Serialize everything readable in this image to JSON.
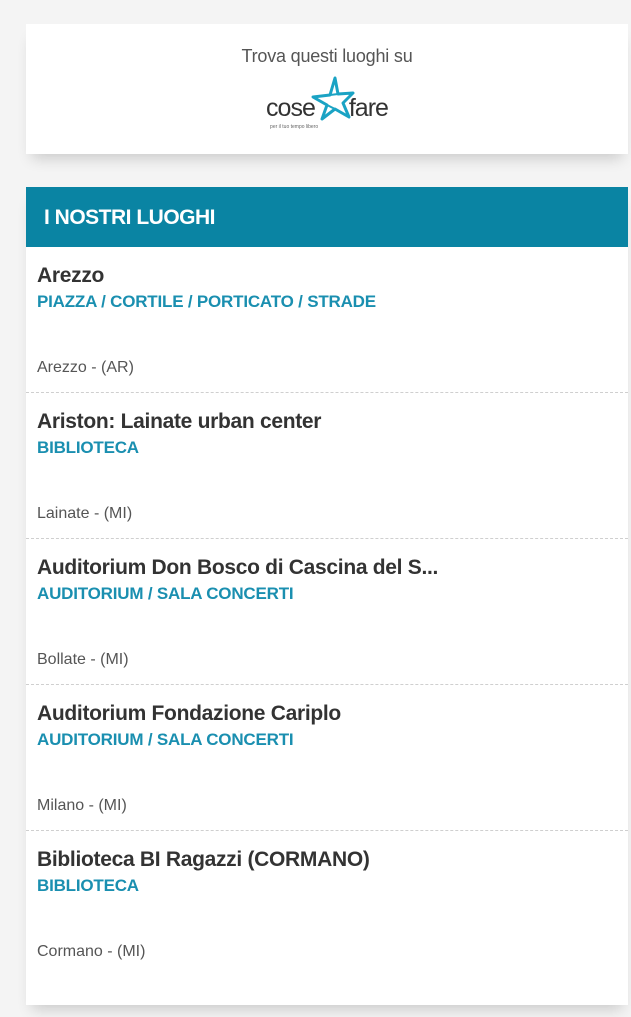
{
  "promo": {
    "text": "Trova questi luoghi su",
    "logo": {
      "left_word": "cose",
      "right_word": "fare",
      "tagline": "per il tuo tempo libero",
      "star_color": "#1aa3c4",
      "icon": "star-logo-icon"
    }
  },
  "places": {
    "header": "I NOSTRI LUOGHI",
    "header_color": "#0a84a3",
    "accent_color": "#1a8fb0",
    "items": [
      {
        "name": "Arezzo",
        "category": "PIAZZA / CORTILE / PORTICATO / STRADE",
        "city": "Arezzo - (AR)"
      },
      {
        "name": "Ariston: Lainate urban center",
        "category": "BIBLIOTECA",
        "city": "Lainate - (MI)"
      },
      {
        "name": "Auditorium Don Bosco di Cascina del S...",
        "category": "AUDITORIUM / SALA CONCERTI",
        "city": "Bollate - (MI)"
      },
      {
        "name": "Auditorium Fondazione Cariplo",
        "category": "AUDITORIUM / SALA CONCERTI",
        "city": "Milano - (MI)"
      },
      {
        "name": "Biblioteca BI Ragazzi (CORMANO)",
        "category": "BIBLIOTECA",
        "city": "Cormano - (MI)"
      }
    ]
  }
}
